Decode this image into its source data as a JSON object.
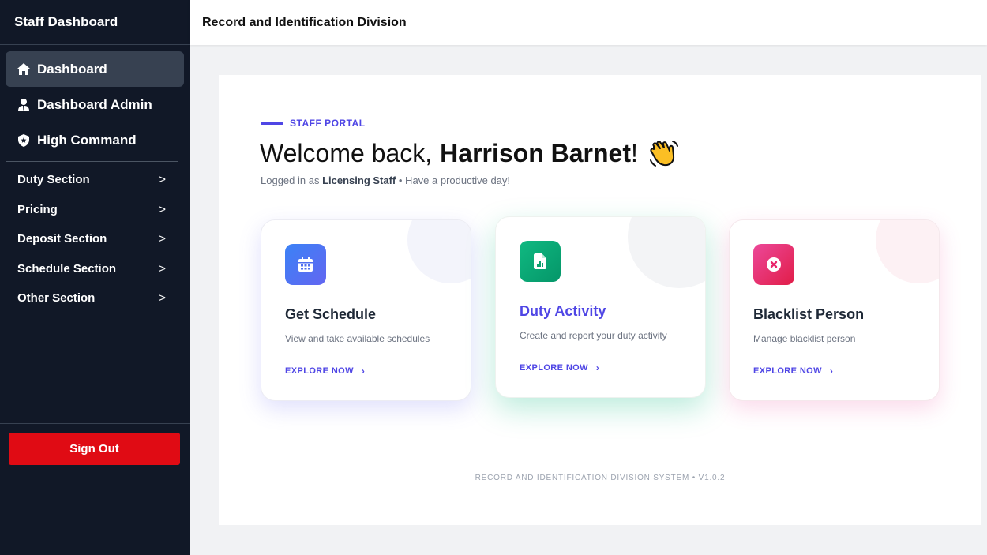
{
  "sidebar": {
    "brand": "Staff Dashboard",
    "nav": [
      {
        "label": "Dashboard",
        "icon": "home-icon",
        "active": true
      },
      {
        "label": "Dashboard Admin",
        "icon": "user-tie-icon",
        "active": false
      },
      {
        "label": "High Command",
        "icon": "shield-icon",
        "active": false
      }
    ],
    "sections": [
      {
        "label": "Duty Section"
      },
      {
        "label": "Pricing"
      },
      {
        "label": "Deposit Section"
      },
      {
        "label": "Schedule Section"
      },
      {
        "label": "Other Section"
      }
    ],
    "chevron": ">",
    "sign_out": "Sign Out"
  },
  "header": {
    "title": "Record and Identification Division"
  },
  "main": {
    "eyebrow": "STAFF PORTAL",
    "welcome_prefix": "Welcome back,",
    "user_name": "Harrison Barnet",
    "welcome_suffix": "!",
    "logged_in_prefix": "Logged in as",
    "role": "Licensing Staff",
    "logged_in_suffix": "• Have a productive day!",
    "cards": [
      {
        "title": "Get Schedule",
        "description": "View and take available schedules",
        "cta": "EXPLORE NOW",
        "icon": "calendar-icon",
        "color": "#4f46e5"
      },
      {
        "title": "Duty Activity",
        "description": "Create and report your duty activity",
        "cta": "EXPLORE NOW",
        "icon": "report-file-icon",
        "color": "#10b981"
      },
      {
        "title": "Blacklist Person",
        "description": "Manage blacklist person",
        "cta": "EXPLORE NOW",
        "icon": "x-circle-icon",
        "color": "#e11d48"
      }
    ],
    "arrow": "›",
    "footer": "RECORD AND IDENTIFICATION DIVISION SYSTEM • V1.0.2"
  }
}
